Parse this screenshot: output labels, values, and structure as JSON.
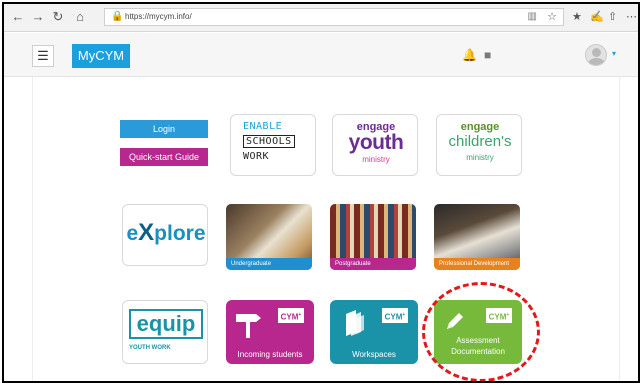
{
  "browser": {
    "back": "←",
    "forward": "→",
    "refresh": "↻",
    "home": "⌂",
    "lock": "🔒",
    "url": "https://mycym.info/",
    "reader": "▥",
    "favorite": "☆",
    "favorites_bar": "★",
    "reading_list": "✍",
    "share": "⇧",
    "more": "⋯"
  },
  "header": {
    "menu_icon": "☰",
    "logo": "MyCYM",
    "notification_icon": "🔔",
    "messages_icon": "■",
    "caret": "▾"
  },
  "buttons": {
    "login": "Login",
    "quick_start": "Quick-start Guide"
  },
  "cards": {
    "enable": [
      "ENABLE",
      "SCHOOLS",
      "WORK"
    ],
    "youth": {
      "engage": "engage",
      "word": "youth",
      "ministry": "ministry"
    },
    "children": {
      "engage": "engage",
      "word": "children's",
      "ministry": "ministry"
    },
    "explore": {
      "x_char": "X",
      "prefix": "e",
      "suffix": "plore"
    },
    "equip": {
      "word": "equip",
      "sub": "YOUTH WORK"
    }
  },
  "photos": {
    "undergraduate": "Undergraduate",
    "postgraduate": "Postgraduate",
    "professional": "Professional Development"
  },
  "tiles": {
    "cym_badge": "CYM",
    "cym_plus": "+",
    "incoming": "Incoming students",
    "workspaces": "Workspaces",
    "assessment_line1": "Assessment",
    "assessment_line2": "Documentation",
    "signpost_icon": "signpost-icon",
    "stack_icon": "stack-icon",
    "pencil_icon": "pencil-icon"
  },
  "colors": {
    "brand_blue": "#1ca0dd",
    "magenta": "#b8278d",
    "teal": "#1a93a8",
    "green": "#77b93b",
    "orange": "#e8821e",
    "highlight_red": "#e01a1a"
  }
}
